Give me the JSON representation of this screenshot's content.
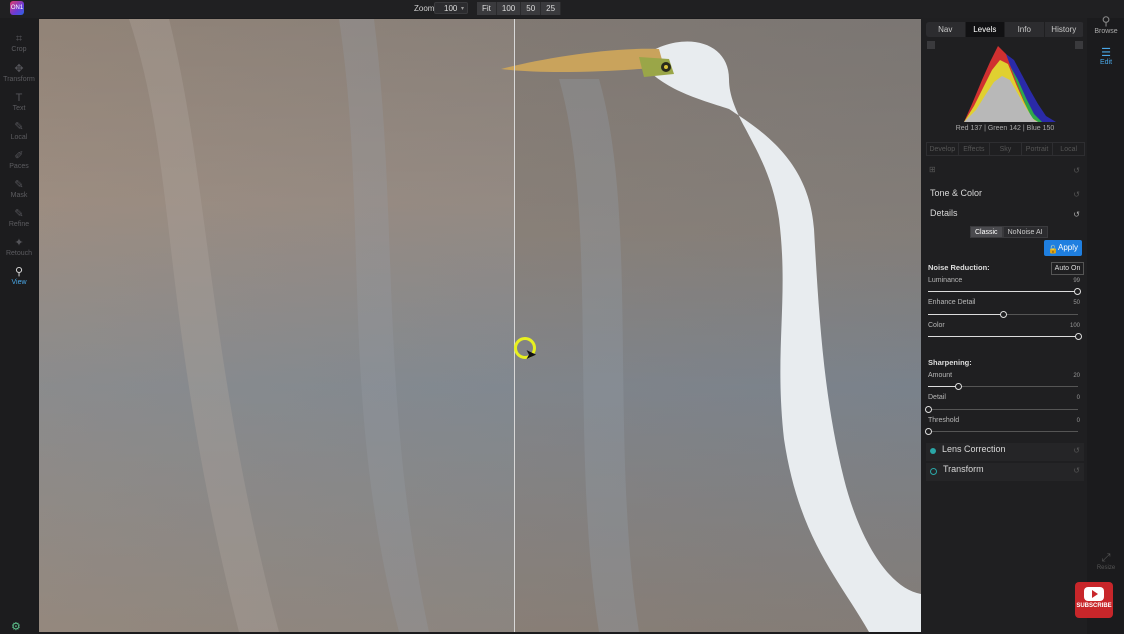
{
  "app": {
    "logo_text": "ON1"
  },
  "toolbar": {
    "zoom_label": "Zoom",
    "zoom_value": "100",
    "zoom_buttons": [
      "Fit",
      "100",
      "50",
      "25"
    ]
  },
  "left_tools": [
    {
      "label": "Crop",
      "icon": "crop-icon",
      "glyph": "⌗"
    },
    {
      "label": "Transform",
      "icon": "transform-icon",
      "glyph": "✥"
    },
    {
      "label": "Text",
      "icon": "text-icon",
      "glyph": "T"
    },
    {
      "label": "Local",
      "icon": "brush-icon",
      "glyph": "✎"
    },
    {
      "label": "Paces",
      "icon": "paces-icon",
      "glyph": "✐"
    },
    {
      "label": "Mask",
      "icon": "mask-icon",
      "glyph": "✎"
    },
    {
      "label": "Refine",
      "icon": "refine-icon",
      "glyph": "✎"
    },
    {
      "label": "Retouch",
      "icon": "retouch-icon",
      "glyph": "✦"
    },
    {
      "label": "View",
      "icon": "view-icon",
      "glyph": "⚲",
      "active": true
    }
  ],
  "right_nav": {
    "browse_label": "Browse",
    "edit_label": "Edit",
    "resize_label": "Resize"
  },
  "panel": {
    "tabs": [
      {
        "label": "Nav",
        "selected": false
      },
      {
        "label": "Levels",
        "selected": true
      },
      {
        "label": "Info",
        "selected": false
      },
      {
        "label": "History",
        "selected": false
      }
    ],
    "rgb_readout": "Red 137 | Green 142 | Blue 150",
    "module_tabs": [
      "Develop",
      "Effects",
      "Sky",
      "Portrait",
      "Local"
    ],
    "sections": {
      "tone_color": "Tone & Color",
      "details": "Details",
      "lens_correction": "Lens Correction",
      "transform": "Transform"
    },
    "details": {
      "modes": [
        {
          "label": "Classic",
          "selected": true
        },
        {
          "label": "NoNoise AI",
          "selected": false
        }
      ],
      "apply_label": "Apply",
      "noise_reduction_title": "Noise Reduction:",
      "auto_on_label": "Auto On",
      "sliders_nr": [
        {
          "label": "Luminance",
          "value": 99
        },
        {
          "label": "Enhance Detail",
          "value": 50
        },
        {
          "label": "Color",
          "value": 100
        }
      ],
      "sharpening_title": "Sharpening:",
      "sliders_sharp": [
        {
          "label": "Amount",
          "value": 20
        },
        {
          "label": "Detail",
          "value": 0
        },
        {
          "label": "Threshold",
          "value": 0
        }
      ]
    }
  },
  "overlay": {
    "subscribe_label": "SUBSCRIBE"
  },
  "colors": {
    "accent": "#1f7fe0",
    "lens_dot": "#2aa6a6"
  }
}
